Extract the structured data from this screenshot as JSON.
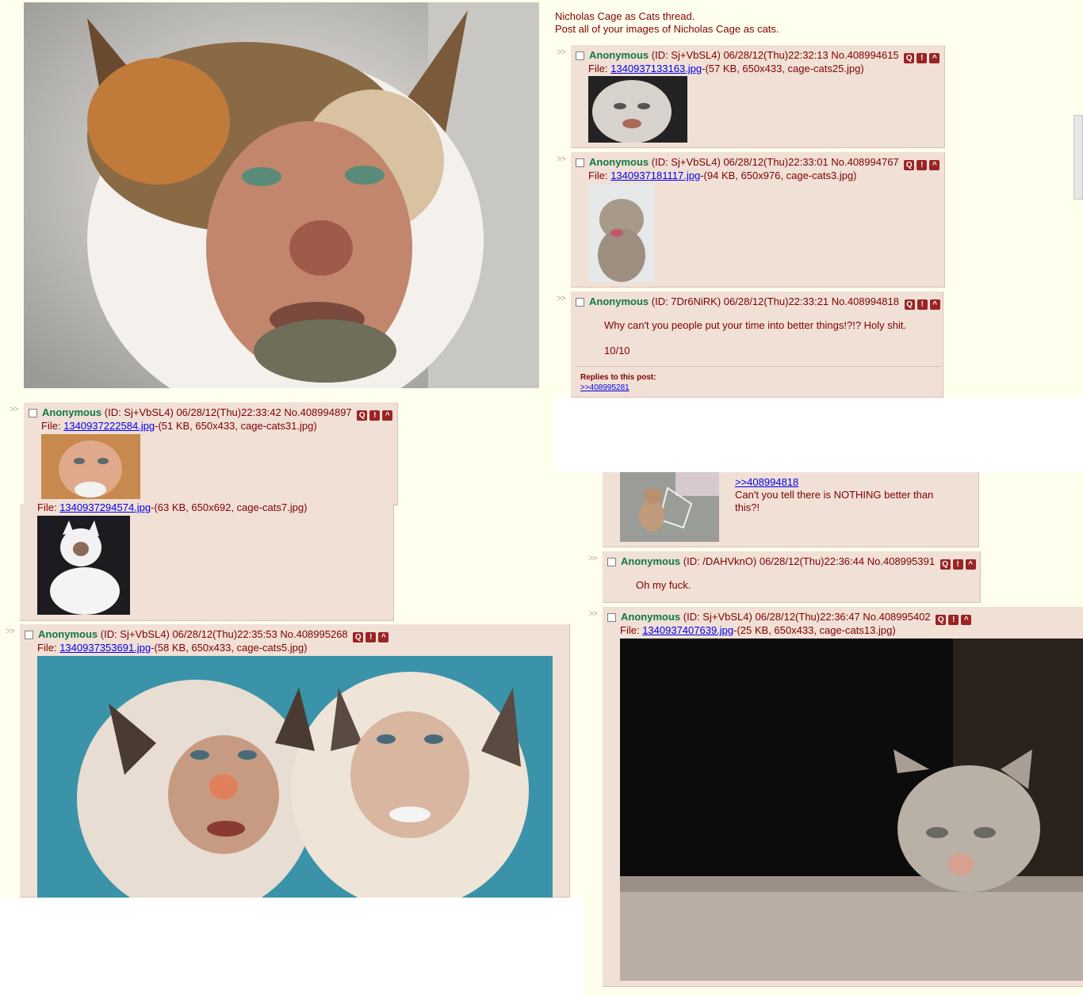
{
  "op": {
    "subject_line": "Nicholas Cage as Cats thread.",
    "body_line": "Post all of your images of Nicholas Cage as cats."
  },
  "arrows": ">>",
  "post_buttons": {
    "quote": "Q",
    "report": "!",
    "expand": "^"
  },
  "posts": [
    {
      "name": "Anonymous",
      "id": "(ID: Sj+VbSL4)",
      "datetime": "06/28/12(Thu)22:32:13",
      "no": "No.408994615",
      "file_label": "File:",
      "file_link": "1340937133163.jpg",
      "file_meta": "-(57 KB, 650x433, cage-cats25.jpg)"
    },
    {
      "name": "Anonymous",
      "id": "(ID: Sj+VbSL4)",
      "datetime": "06/28/12(Thu)22:33:01",
      "no": "No.408994767",
      "file_label": "File:",
      "file_link": "1340937181117.jpg",
      "file_meta": "-(94 KB, 650x976, cage-cats3.jpg)"
    },
    {
      "name": "Anonymous",
      "id": "(ID: 7Dr6NiRK)",
      "datetime": "06/28/12(Thu)22:33:21",
      "no": "No.408994818",
      "comment1": "Why can't you people put your time into better things!?!? Holy shit.",
      "comment2": "10/10",
      "replies_label": "Replies to this post:",
      "reply_link": ">>408995281"
    },
    {
      "name": "Anonymous",
      "id": "(ID: Sj+VbSL4)",
      "datetime": "06/28/12(Thu)22:33:42",
      "no": "No.408994897",
      "file_label": "File:",
      "file_link": "1340937222584.jpg",
      "file_meta": "-(51 KB, 650x433, cage-cats31.jpg)"
    },
    {
      "file_label": "File:",
      "file_link": "1340937294574.jpg",
      "file_meta": "-(63 KB, 650x692, cage-cats7.jpg)"
    },
    {
      "name": "Anonymous",
      "id": "(ID: Sj+VbSL4)",
      "datetime": "06/28/12(Thu)22:35:53",
      "no": "No.408995268",
      "file_label": "File:",
      "file_link": "1340937353691.jpg",
      "file_meta": "-(58 KB, 650x433, cage-cats5.jpg)"
    },
    {
      "quote_link": ">>408994818",
      "comment": "Can't you tell there is NOTHING better than this?!"
    },
    {
      "name": "Anonymous",
      "id": "(ID: /DAHVknO)",
      "datetime": "06/28/12(Thu)22:36:44",
      "no": "No.408995391",
      "comment": "Oh my fuck."
    },
    {
      "name": "Anonymous",
      "id": "(ID: Sj+VbSL4)",
      "datetime": "06/28/12(Thu)22:36:47",
      "no": "No.408995402",
      "file_label": "File:",
      "file_link": "1340937407639.jpg",
      "file_meta": "-(25 KB, 650x433, cage-cats13.jpg)"
    }
  ],
  "colors": {
    "background": "#ffffee",
    "post_bg": "#f0e0d6",
    "name": "#117743",
    "text": "#800000",
    "link": "#0000ee"
  }
}
